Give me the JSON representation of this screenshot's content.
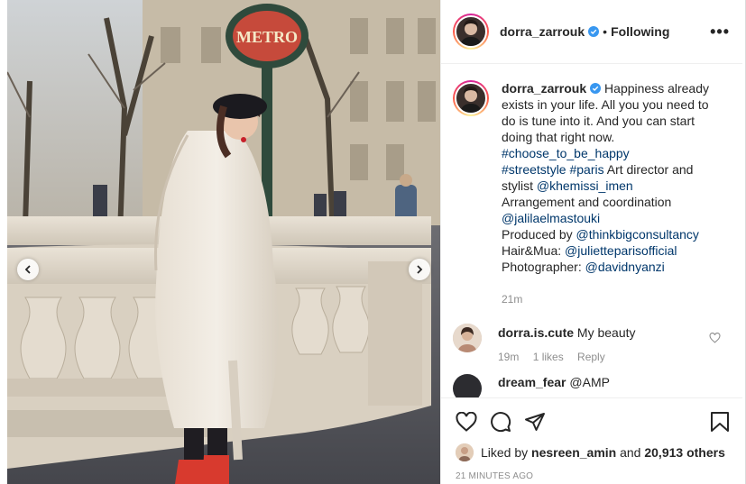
{
  "post": {
    "image_alt": "Woman in cream fur coat and red boots in Paris near Metro sign",
    "sign_text": "METRO",
    "carousel": {
      "prev_icon": "chevron-left-icon",
      "next_icon": "chevron-right-icon"
    }
  },
  "header": {
    "username": "dorra_zarrouk",
    "verified_icon": "verified-badge-icon",
    "separator": "•",
    "follow_status": "Following",
    "more_icon": "more-options-icon",
    "more_label": "•••"
  },
  "caption": {
    "username": "dorra_zarrouk",
    "text_1": " Happiness already exists in your life. All you you need to do is tune into it. And you can start doing that right now.",
    "hashtag_1": "#choose_to_be_happy",
    "hashtag_2": "#streetstyle",
    "hashtag_3": "#paris",
    "text_2": " Art director and stylist ",
    "mention_1": "@khemissi_imen",
    "text_3": "Arrangement and coordination",
    "mention_2": "@jalilaelmastouki",
    "text_4": "Produced by ",
    "mention_3": "@thinkbigconsultancy",
    "text_5": "Hair&Mua: ",
    "mention_4": "@julietteparisofficial",
    "text_6": "Photographer: ",
    "mention_5": "@davidnyanzi",
    "time": "21m"
  },
  "comments": [
    {
      "username": "dorra.is.cute",
      "text": "My beauty",
      "time": "19m",
      "likes": "1 likes",
      "reply": "Reply"
    }
  ],
  "peek_comment": {
    "username": "dream_fear",
    "text": "@AMP"
  },
  "actions": {
    "like_icon": "heart-icon",
    "comment_icon": "comment-icon",
    "share_icon": "send-icon",
    "save_icon": "bookmark-icon"
  },
  "likes": {
    "prefix": "Liked by ",
    "user": "nesreen_amin",
    "middle": " and ",
    "count": "20,913 others"
  },
  "timestamp": "21 MINUTES AGO"
}
